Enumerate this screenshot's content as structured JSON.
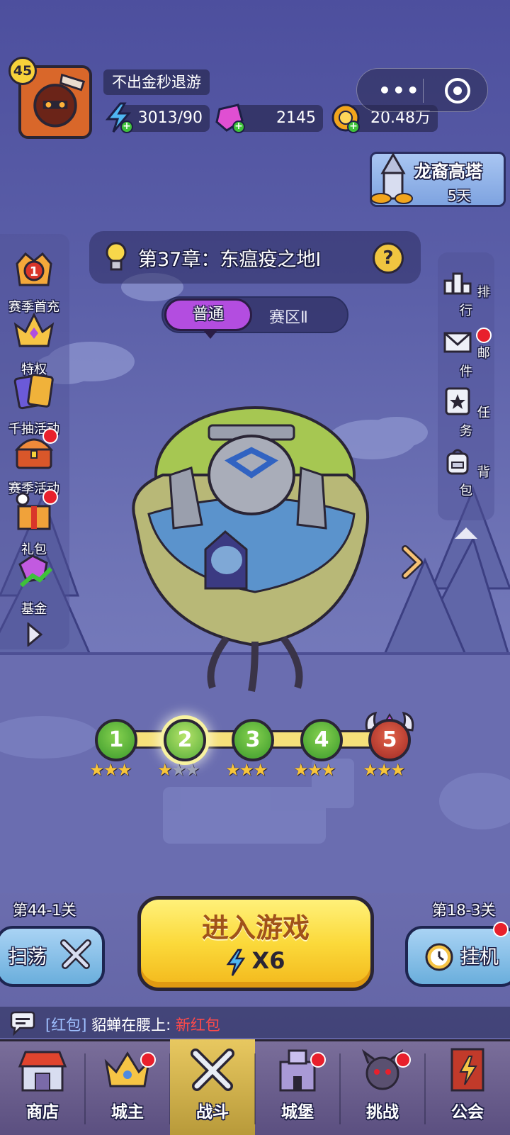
{
  "player": {
    "level": "45",
    "nickname": "不出金秒退游"
  },
  "resources": {
    "energy": "3013/90",
    "gems": "2145",
    "gold": "20.48万"
  },
  "capsule": {
    "more": "•••"
  },
  "tower_event": {
    "title": "龙裔高塔",
    "days": "5天"
  },
  "chapter": {
    "title": "第37章：东瘟疫之地Ⅰ",
    "help": "?"
  },
  "mode": {
    "active": "普通",
    "inactive": "赛区Ⅱ"
  },
  "left_menu": [
    {
      "label": "赛季首充",
      "badge": "1"
    },
    {
      "label": "特权"
    },
    {
      "label": "千抽活动"
    },
    {
      "label": "赛季活动"
    },
    {
      "label": "礼包"
    },
    {
      "label": "基金"
    }
  ],
  "right_menu": [
    {
      "label": "排行"
    },
    {
      "label": "邮件"
    },
    {
      "label": "任务"
    },
    {
      "label": "背包"
    }
  ],
  "stages": [
    {
      "number": "1",
      "stars": 3
    },
    {
      "number": "2",
      "stars": 1
    },
    {
      "number": "3",
      "stars": 3
    },
    {
      "number": "4",
      "stars": 3
    },
    {
      "number": "5",
      "stars": 3
    }
  ],
  "controls": {
    "sweep_stage": "第44-1关",
    "sweep_label": "扫荡",
    "start_label": "进入游戏",
    "start_cost": "X6",
    "idle_stage": "第18-3关",
    "idle_label": "挂机"
  },
  "chat": {
    "tag": "[红包]",
    "sender": "貂蝉在腰上:",
    "message": "新红包"
  },
  "nav": [
    {
      "label": "商店"
    },
    {
      "label": "城主"
    },
    {
      "label": "战斗"
    },
    {
      "label": "城堡"
    },
    {
      "label": "挑战"
    },
    {
      "label": "公会"
    }
  ],
  "colors": {
    "accent_yellow": "#fbd93a",
    "mode_purple": "#b34de0",
    "badge_red": "#e8202c",
    "node_green": "#3b9a2c",
    "boss_red": "#a12a24"
  }
}
